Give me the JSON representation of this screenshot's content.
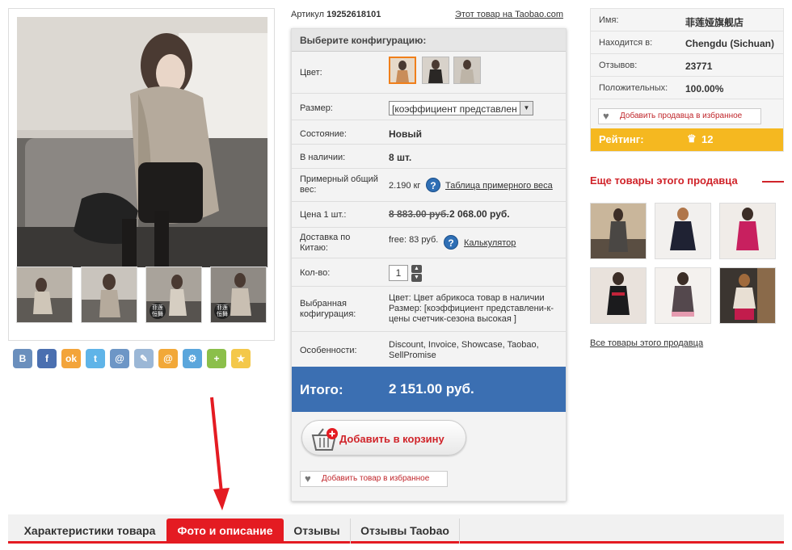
{
  "product": {
    "sku_label": "Артикул",
    "sku_value": "19252618101",
    "taobao_link": "Этот товар на Taobao.com"
  },
  "gallery": {
    "main_image": "woman-in-beige-coat-photo",
    "thumbnails": [
      "coat-thumb-1",
      "coat-thumb-2",
      "coat-thumb-3",
      "coat-thumb-4"
    ],
    "thumb_badge": "菲莲 恒舞"
  },
  "social": [
    {
      "icon": "vk-icon",
      "glyph": "B",
      "color": "#6a8fbd"
    },
    {
      "icon": "facebook-icon",
      "glyph": "f",
      "color": "#4a6fb0"
    },
    {
      "icon": "odnoklassniki-icon",
      "glyph": "ok",
      "color": "#f3a43a"
    },
    {
      "icon": "twitter-icon",
      "glyph": "t",
      "color": "#5fb4e8"
    },
    {
      "icon": "myworld-icon",
      "glyph": "@",
      "color": "#6d96c6"
    },
    {
      "icon": "livejournal-icon",
      "glyph": "✎",
      "color": "#9bb7d6"
    },
    {
      "icon": "mailru-icon",
      "glyph": "@",
      "color": "#f2a838"
    },
    {
      "icon": "settings-share-icon",
      "glyph": "⚙",
      "color": "#5aa6dc"
    },
    {
      "icon": "google-plus-icon",
      "glyph": "+",
      "color": "#8bbf4a"
    },
    {
      "icon": "bookmark-star-icon",
      "glyph": "★",
      "color": "#f4c84a"
    }
  ],
  "config": {
    "title": "Выберите конфигурацию:",
    "color_label": "Цвет:",
    "size_label": "Размер:",
    "size_value": "[коэффициент представлен",
    "condition_label": "Состояние:",
    "condition_value": "Новый",
    "stock_label": "В наличии:",
    "stock_value": "8 шт.",
    "weight_label": "Примерный общий вес:",
    "weight_value": "2.190 кг",
    "weight_link": "Таблица примерного веса",
    "price_label": "Цена 1 шт.:",
    "price_old": "8 883.00 руб.",
    "price_new": "2 068.00 руб.",
    "delivery_label": "Доставка по Китаю:",
    "delivery_value": "free: 83 руб.",
    "delivery_link": "Калькулятор",
    "qty_label": "Кол-во:",
    "qty_value": "1",
    "selected_label": "Выбранная кофигурация:",
    "selected_value": "Цвет: Цвет абрикоса товар в наличии Размер: [коэффициент представлени-к-цены счетчик-сезона высокая ]",
    "features_label": "Особенности:",
    "features_value": "Discount, Invoice, Showcase, Taobao, SellPromise",
    "help_glyph": "?",
    "total_label": "Итого:",
    "total_value": "2 151.00 руб.",
    "cart_button": "Добавить в корзину",
    "fav_item_button": "Добавить товар в избранное"
  },
  "seller": {
    "rows": [
      {
        "key": "Имя:",
        "value": "菲莲娅旗舰店"
      },
      {
        "key": "Находится в:",
        "value": "Chengdu (Sichuan)"
      },
      {
        "key": "Отзывов:",
        "value": "23771"
      },
      {
        "key": "Положительных:",
        "value": "100.00%"
      }
    ],
    "fav_button": "Добавить продавца в избранное",
    "rating_label": "Рейтинг:",
    "rating_value": "12",
    "more_title": "Еще товары этого продавца",
    "all_goods_link": "Все товары этого продавца"
  },
  "tabs": [
    {
      "label": "Характеристики товара",
      "active": false
    },
    {
      "label": "Фото и описание",
      "active": true
    },
    {
      "label": "Отзывы",
      "active": false
    },
    {
      "label": "Отзывы Taobao",
      "active": false
    }
  ],
  "colors": {
    "accent_red": "#e41b22",
    "total_blue": "#3b6fb2",
    "rating_yellow": "#f5b820",
    "swatch_selected": "#f07f1a"
  }
}
